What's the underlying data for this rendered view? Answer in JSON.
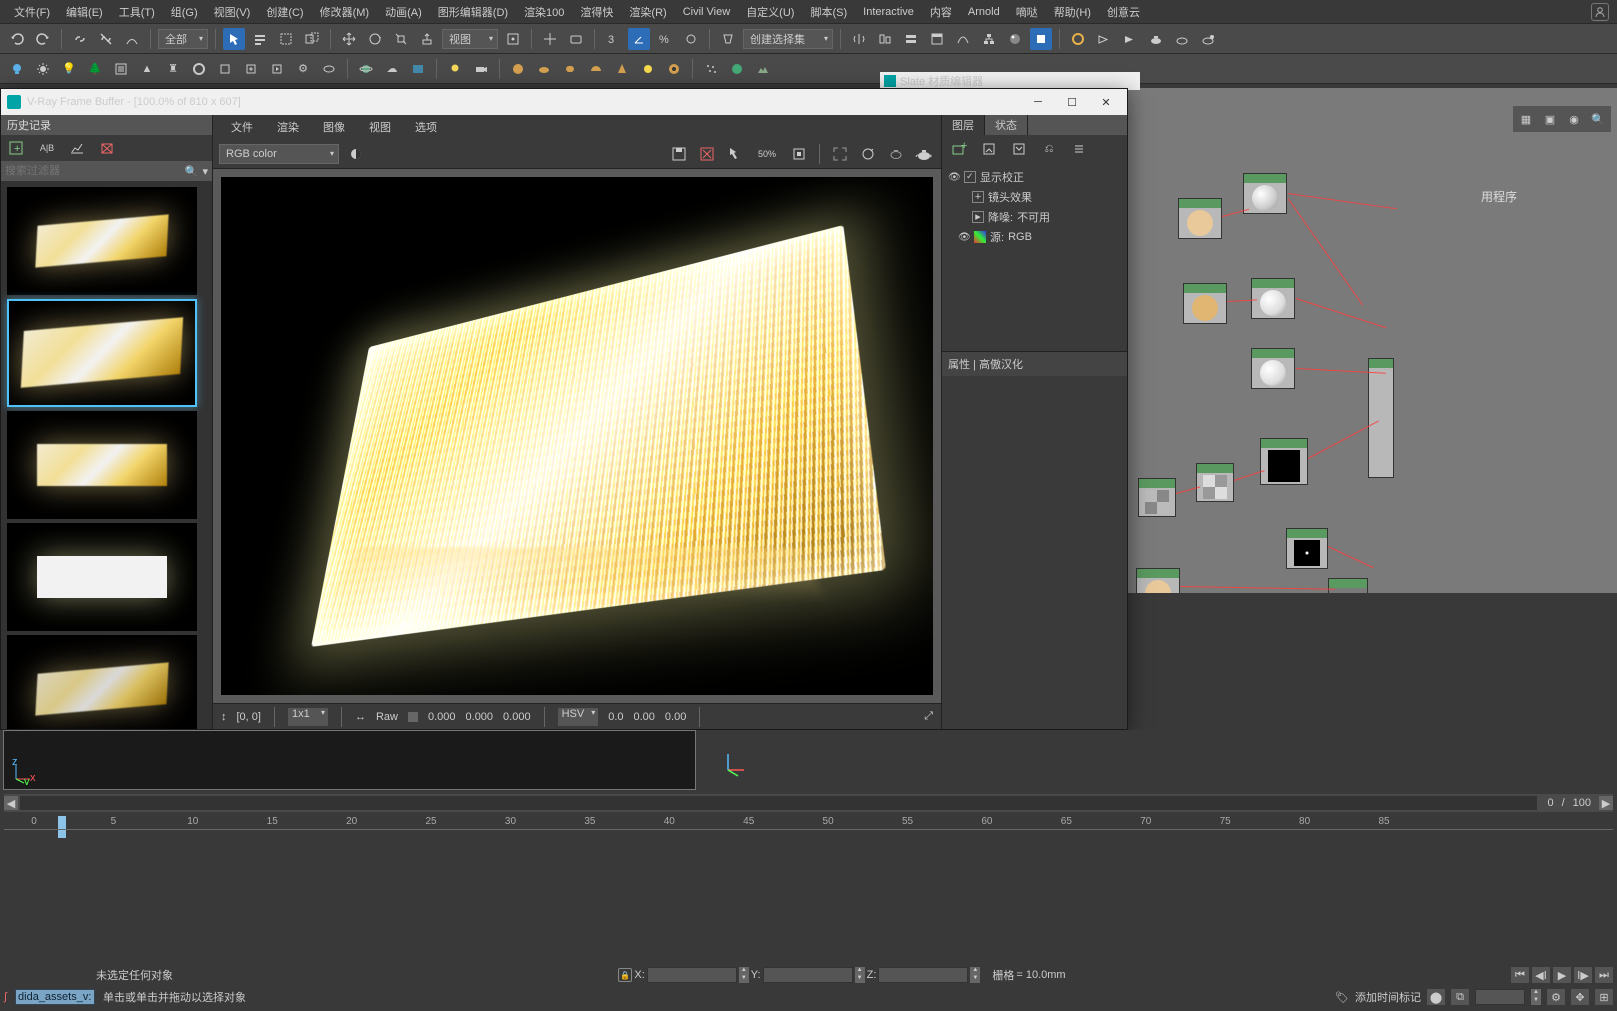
{
  "menu": [
    "文件(F)",
    "编辑(E)",
    "工具(T)",
    "组(G)",
    "视图(V)",
    "创建(C)",
    "修改器(M)",
    "动画(A)",
    "图形编辑器(D)",
    "渲染100",
    "渲得快",
    "渲染(R)",
    "Civil View",
    "自定义(U)",
    "脚本(S)",
    "Interactive",
    "内容",
    "Arnold",
    "嘀哒",
    "帮助(H)",
    "创意云"
  ],
  "toolbar1": {
    "scope": "全部",
    "selset": "创建选择集"
  },
  "vfb": {
    "title": "V-Ray Frame Buffer - [100.0% of 810 x 607]",
    "history": "历史记录",
    "search_ph": "搜索过滤器",
    "menu": [
      "文件",
      "渲染",
      "图像",
      "视图",
      "选项"
    ],
    "channel": "RGB color",
    "zoom": "50%",
    "coords": "[0, 0]",
    "grid": "1x1",
    "raw": "Raw",
    "raw_vals": [
      "0.000",
      "0.000",
      "0.000"
    ],
    "space": "HSV",
    "hsv_vals": [
      "0.0",
      "0.00",
      "0.00"
    ],
    "tabs": {
      "layers": "图层",
      "state": "状态"
    },
    "tree": {
      "root": "显示校正",
      "lens": "镜头效果",
      "denoise_l": "降噪:",
      "denoise_v": "不可用",
      "src_l": "源:",
      "src_v": "RGB"
    },
    "attr": "属性 | 高傲汉化"
  },
  "slate": {
    "title": "Slate 材质编辑器",
    "side": "用程序"
  },
  "timeline": {
    "pos": "0",
    "sep": "/",
    "total": "100",
    "marks": [
      "0",
      "5",
      "10",
      "15",
      "20",
      "25",
      "30",
      "35",
      "40",
      "45",
      "50",
      "55",
      "60",
      "65",
      "70",
      "75",
      "80",
      "85"
    ]
  },
  "status": {
    "nosel": "未选定任何对象",
    "hint": "单击或单击并拖动以选择对象",
    "grid_l": "栅格",
    "grid_v": "= 10.0mm",
    "add": "添加时间标记",
    "x": "X:",
    "y": "Y:",
    "z": "Z:"
  },
  "cmd": "dida_assets_v:"
}
